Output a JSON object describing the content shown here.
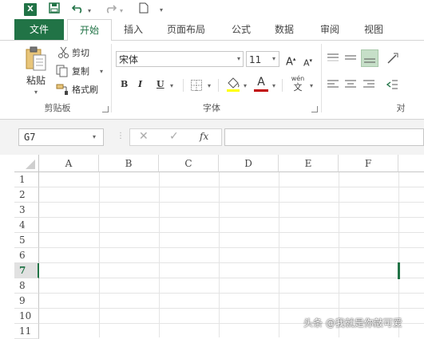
{
  "quick_access": {
    "app_logo": "X",
    "save_icon": "save-icon",
    "undo_icon": "undo-icon",
    "redo_icon": "redo-icon",
    "new_icon": "new-doc-icon",
    "customize_icon": "customize-qat-icon"
  },
  "tabs": {
    "file": "文件",
    "home": "开始",
    "insert": "插入",
    "page_layout": "页面布局",
    "formulas": "公式",
    "data": "数据",
    "review": "审阅",
    "view": "视图"
  },
  "clipboard": {
    "paste": "粘贴",
    "cut": "剪切",
    "copy": "复制",
    "format_painter": "格式刷",
    "group_label": "剪贴板"
  },
  "font": {
    "name": "宋体",
    "size": "11",
    "grow": "A",
    "shrink": "A",
    "bold": "B",
    "italic": "I",
    "underline": "U",
    "font_color": "A",
    "phonetic_top": "wén",
    "phonetic_bottom": "文",
    "group_label": "字体"
  },
  "alignment": {
    "group_label_partial": "对"
  },
  "formula_bar": {
    "name_box": "G7",
    "cancel": "✕",
    "enter": "✓",
    "fx": "fx"
  },
  "columns": [
    "A",
    "B",
    "C",
    "D",
    "E",
    "F"
  ],
  "rows": [
    "1",
    "2",
    "3",
    "4",
    "5",
    "6",
    "7",
    "8",
    "9",
    "10",
    "11"
  ],
  "active_row": "7",
  "active_cell": "G7",
  "watermark": "头条 @我就是你敲可爱",
  "colors": {
    "brand": "#217346",
    "grid_line": "#e4e4e4",
    "font_red": "#c00000"
  }
}
